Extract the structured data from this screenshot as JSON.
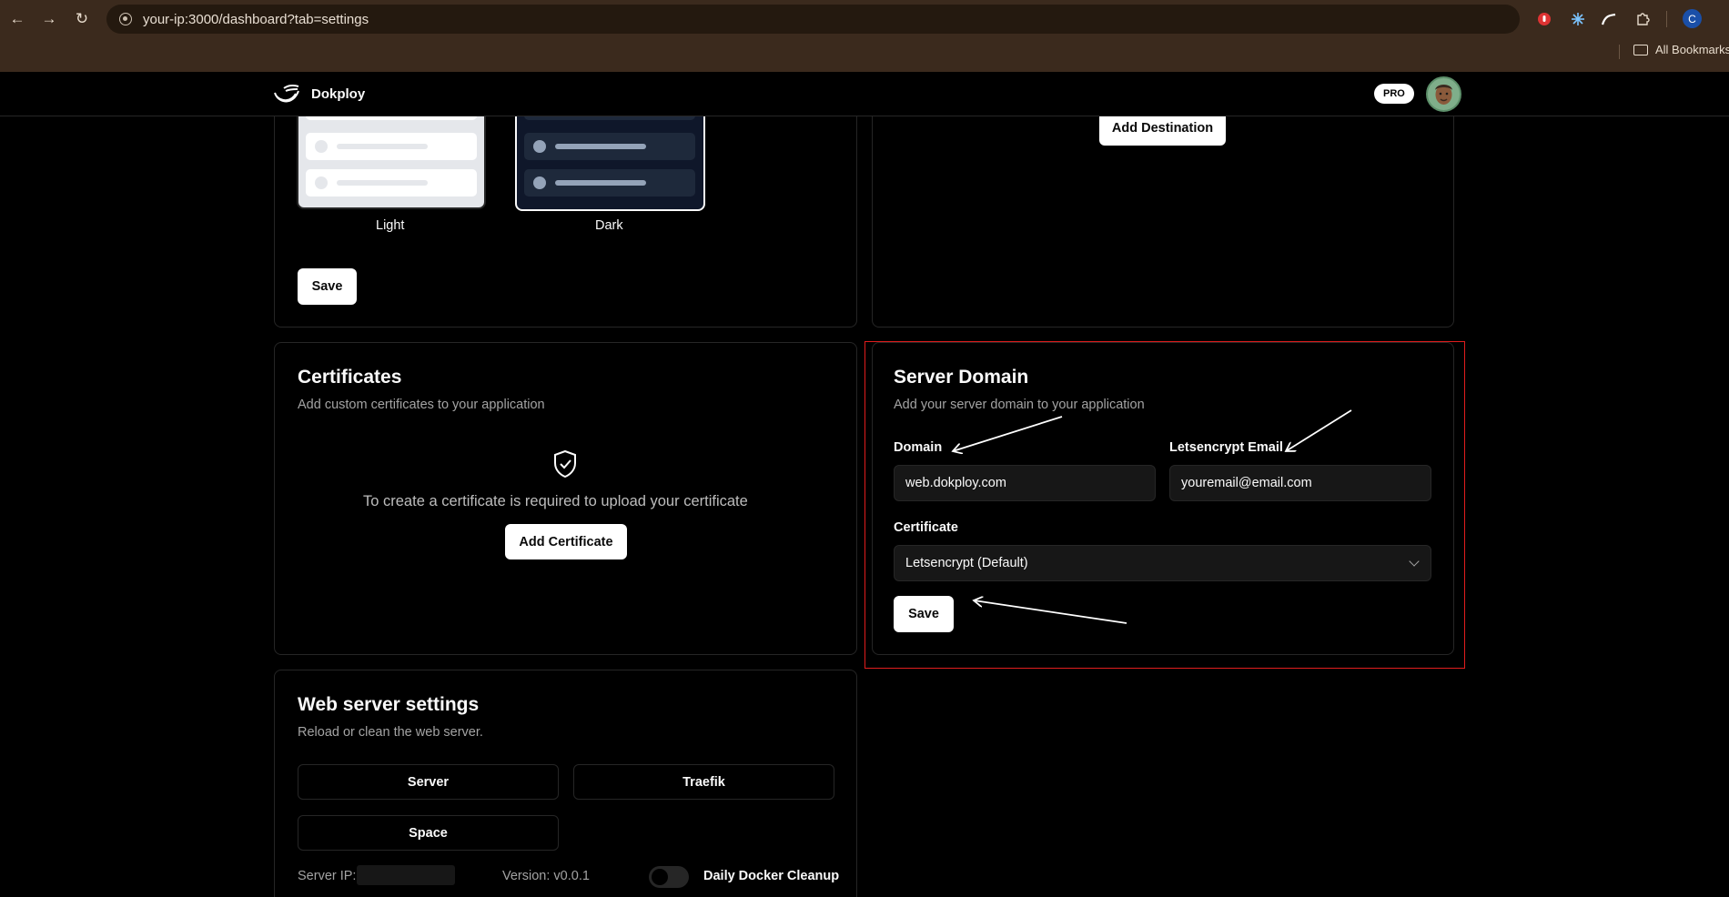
{
  "browser": {
    "url": "your-ip:3000/dashboard?tab=settings",
    "bookmarks_label": "All Bookmarks",
    "profile_initial": "C"
  },
  "header": {
    "brand": "Dokploy",
    "badge": "PRO"
  },
  "appearance": {
    "themes": [
      {
        "label": "Light",
        "selected": false
      },
      {
        "label": "Dark",
        "selected": true
      }
    ],
    "save_label": "Save"
  },
  "destinations": {
    "add_label": "Add Destination"
  },
  "certificates": {
    "title": "Certificates",
    "description": "Add custom certificates to your application",
    "empty_text": "To create a certificate is required to upload your certificate",
    "add_label": "Add Certificate"
  },
  "server_domain": {
    "title": "Server Domain",
    "description": "Add your server domain to your application",
    "domain_label": "Domain",
    "domain_value": "web.dokploy.com",
    "email_label": "Letsencrypt Email",
    "email_value": "youremail@email.com",
    "certificate_label": "Certificate",
    "certificate_value": "Letsencrypt (Default)",
    "save_label": "Save"
  },
  "web_server": {
    "title": "Web server settings",
    "description": "Reload or clean the web server.",
    "buttons": [
      "Server",
      "Traefik",
      "Space"
    ],
    "server_ip_label": "Server IP:",
    "version": "Version: v0.0.1",
    "cleanup_label": "Daily Docker Cleanup",
    "cleanup_enabled": false
  },
  "colors": {
    "highlight": "#e11d1d",
    "background": "#000000",
    "card_border": "#262626",
    "chrome": "#3b2a1d"
  }
}
